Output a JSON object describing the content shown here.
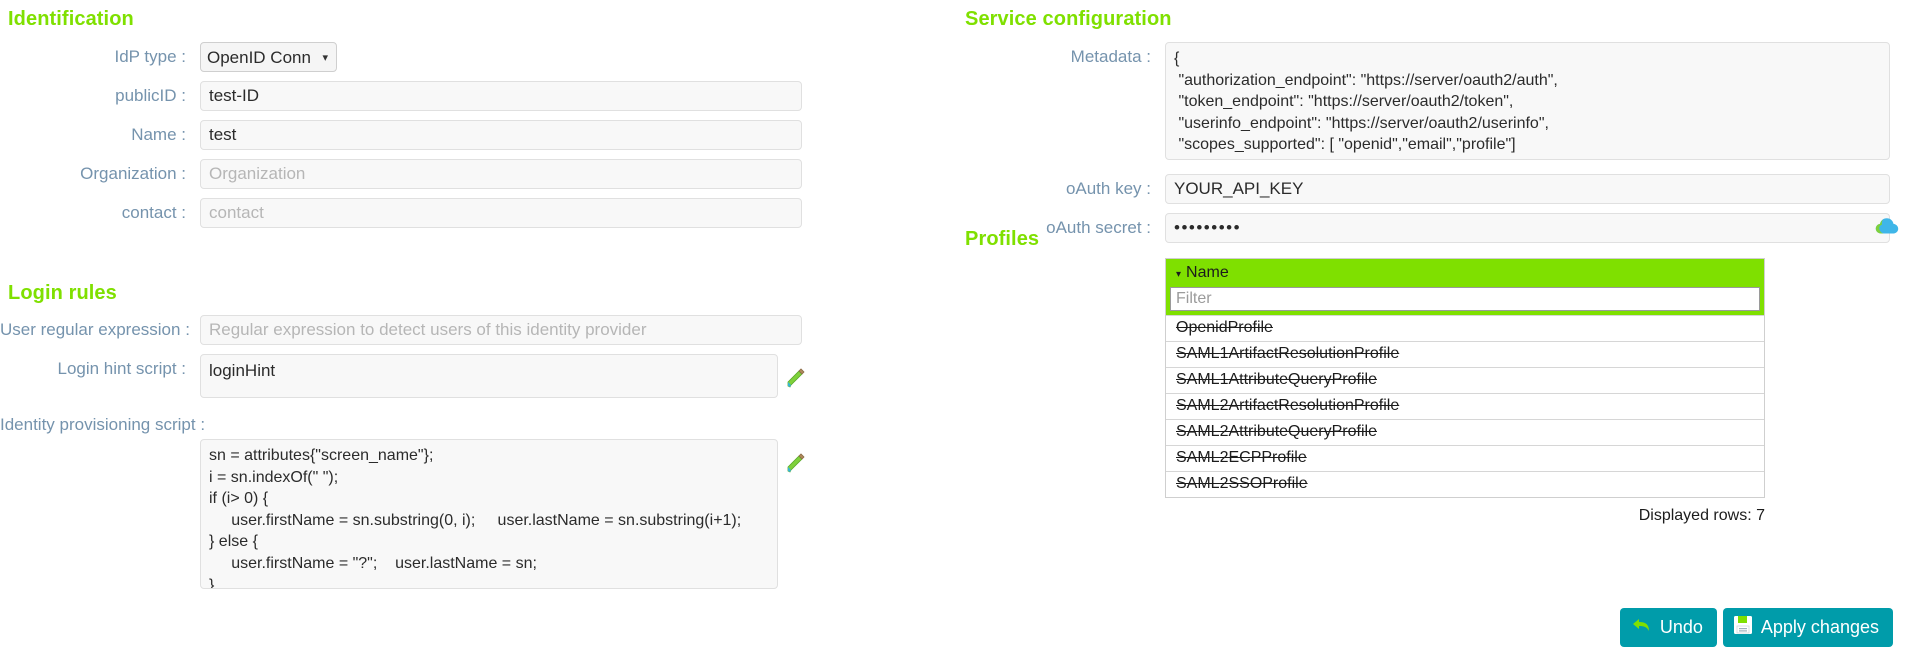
{
  "sections": {
    "identification": "Identification",
    "login_rules": "Login rules",
    "service_configuration": "Service configuration",
    "profiles": "Profiles"
  },
  "identification": {
    "idp_type": {
      "label": "IdP type :",
      "value": "OpenID Connect",
      "options": [
        "OpenID Connect"
      ]
    },
    "public_id": {
      "label": "publicID :",
      "value": "test-ID",
      "placeholder": ""
    },
    "name": {
      "label": "Name :",
      "value": "test",
      "placeholder": ""
    },
    "organization": {
      "label": "Organization :",
      "value": "",
      "placeholder": "Organization"
    },
    "contact": {
      "label": "contact :",
      "value": "",
      "placeholder": "contact"
    }
  },
  "login_rules": {
    "user_regex": {
      "label": "User regular expression :",
      "value": "",
      "placeholder": "Regular expression to detect users of this identity provider"
    },
    "login_hint": {
      "label": "Login hint script :",
      "value": "loginHint"
    },
    "identity_provisioning": {
      "label": "Identity provisioning script :",
      "value": "sn = attributes{\"screen_name\"};\ni = sn.indexOf(\" \");\nif (i> 0) {\n     user.firstName = sn.substring(0, i);     user.lastName = sn.substring(i+1);\n} else {\n     user.firstName = \"?\";    user.lastName = sn;\n}\nreturn attributes{\"name\"};"
    }
  },
  "service_configuration": {
    "metadata": {
      "label": "Metadata :",
      "value": "{\n \"authorization_endpoint\": \"https://server/oauth2/auth\",\n \"token_endpoint\": \"https://server/oauth2/token\",\n \"userinfo_endpoint\": \"https://server/oauth2/userinfo\",\n \"scopes_supported\": [ \"openid\",\"email\",\"profile\"]\n}"
    },
    "oauth_key": {
      "label": "oAuth key :",
      "value": "YOUR_API_KEY"
    },
    "oauth_secret": {
      "label": "oAuth secret :",
      "value": "•••••••••"
    }
  },
  "profiles": {
    "column_header": "Name",
    "sort_arrow": "▾",
    "filter_placeholder": "Filter",
    "filter_value": "",
    "rows": [
      "OpenidProfile",
      "SAML1ArtifactResolutionProfile",
      "SAML1AttributeQueryProfile",
      "SAML2ArtifactResolutionProfile",
      "SAML2AttributeQueryProfile",
      "SAML2ECPProfile",
      "SAML2SSOProfile"
    ],
    "displayed_rows": "Displayed rows: 7"
  },
  "footer": {
    "undo": "Undo",
    "apply": "Apply changes"
  },
  "colors": {
    "accent_green": "#7fe000",
    "label_blue": "#7593ad",
    "button_teal": "#009caa",
    "cloud_blue": "#3fb6e8"
  }
}
